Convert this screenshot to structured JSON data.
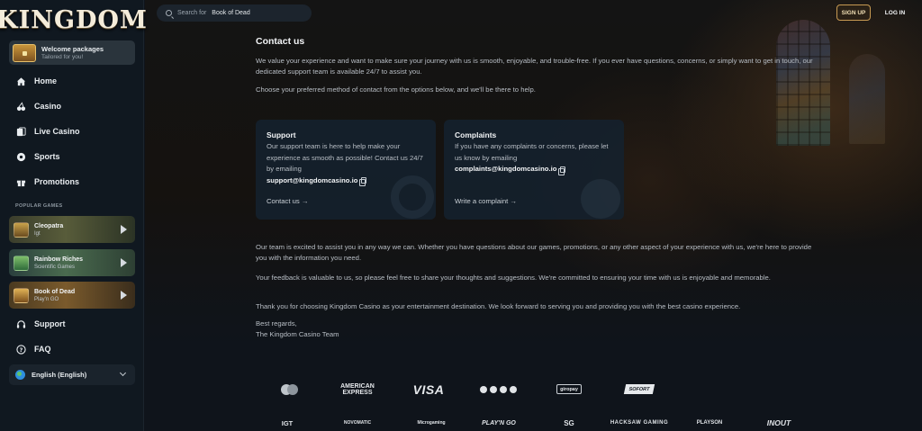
{
  "brand": {
    "logo_text": "KINGDOM"
  },
  "sidebar": {
    "welcome": {
      "title": "Welcome packages",
      "subtitle": "Tailored for you!"
    },
    "nav": [
      {
        "label": "Home",
        "icon": "home-icon"
      },
      {
        "label": "Casino",
        "icon": "cherries-icon"
      },
      {
        "label": "Live Casino",
        "icon": "cards-icon"
      },
      {
        "label": "Sports",
        "icon": "ball-icon"
      },
      {
        "label": "Promotions",
        "icon": "gift-icon"
      }
    ],
    "popular_label": "POPULAR GAMES",
    "games": [
      {
        "name": "Cleopatra",
        "provider": "Igt"
      },
      {
        "name": "Rainbow Riches",
        "provider": "Scientific Games"
      },
      {
        "name": "Book of Dead",
        "provider": "Play'n GO"
      }
    ],
    "nav2": [
      {
        "label": "Support",
        "icon": "headset-icon"
      },
      {
        "label": "FAQ",
        "icon": "help-circle-icon"
      }
    ],
    "language": "English (English)"
  },
  "header": {
    "search": {
      "placeholder": "Search for",
      "query": "Book of Dead"
    },
    "signup": "SIGN UP",
    "login": "LOG IN"
  },
  "main": {
    "title": "Contact us",
    "intro": "We value your experience and want to make sure your journey with us is smooth, enjoyable, and trouble-free. If you ever have questions, concerns, or simply want to get in touch, our dedicated support team is available 24/7 to assist you.",
    "choose": "Choose your preferred method of contact from the options below, and we'll be there to help.",
    "cards": [
      {
        "title": "Support",
        "text": "Our support team is here to help make your experience as smooth as possible! Contact us 24/7 by emailing",
        "email": "support@kingdomcasino.io",
        "link": "Contact us →"
      },
      {
        "title": "Complaints",
        "text": "If you have any complaints or concerns, please let us know by emailing",
        "email": "complaints@kingdomcasino.io",
        "link": "Write a complaint →"
      }
    ],
    "para_assist": "Our team is excited to assist you in any way we can. Whether you have questions about our games, promotions, or any other aspect of your experience with us, we're here to provide you with the information you need.",
    "para_feedback": "Your feedback is valuable to us, so please feel free to share your thoughts and suggestions. We're committed to ensuring your time with us is enjoyable and memorable.",
    "para_thanks": "Thank you for choosing Kingdom Casino as your entertainment destination. We look forward to serving you and providing you with the best casino experience.",
    "sign_off": "Best regards,",
    "sign_name": "The Kingdom Casino Team"
  },
  "footer": {
    "payments": [
      "mastercard",
      "AMERICAN EXPRESS",
      "VISA",
      "••••",
      "giropay",
      "SOFORT"
    ],
    "providers": [
      "IGT",
      "NOVOMATIC",
      "Microgaming",
      "PLAY'N GO",
      "SG",
      "HACKSAW GAMING",
      "PLAYSON",
      "INOUT"
    ]
  }
}
